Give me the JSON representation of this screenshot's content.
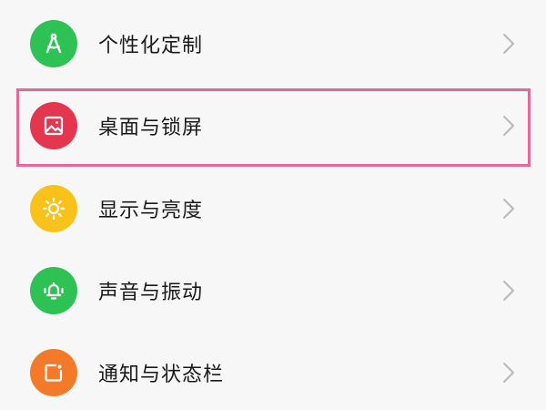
{
  "settings": {
    "items": [
      {
        "label": "个性化定制",
        "icon": "compass-icon",
        "color": "#2ec255"
      },
      {
        "label": "桌面与锁屏",
        "icon": "image-icon",
        "color": "#e4364f"
      },
      {
        "label": "显示与亮度",
        "icon": "sun-icon",
        "color": "#f8c21b"
      },
      {
        "label": "声音与振动",
        "icon": "bell-icon",
        "color": "#2ec255"
      },
      {
        "label": "通知与状态栏",
        "icon": "notification-icon",
        "color": "#f37a2a"
      }
    ]
  },
  "highlight": {
    "color": "#e4699a",
    "target": "桌面与锁屏"
  }
}
